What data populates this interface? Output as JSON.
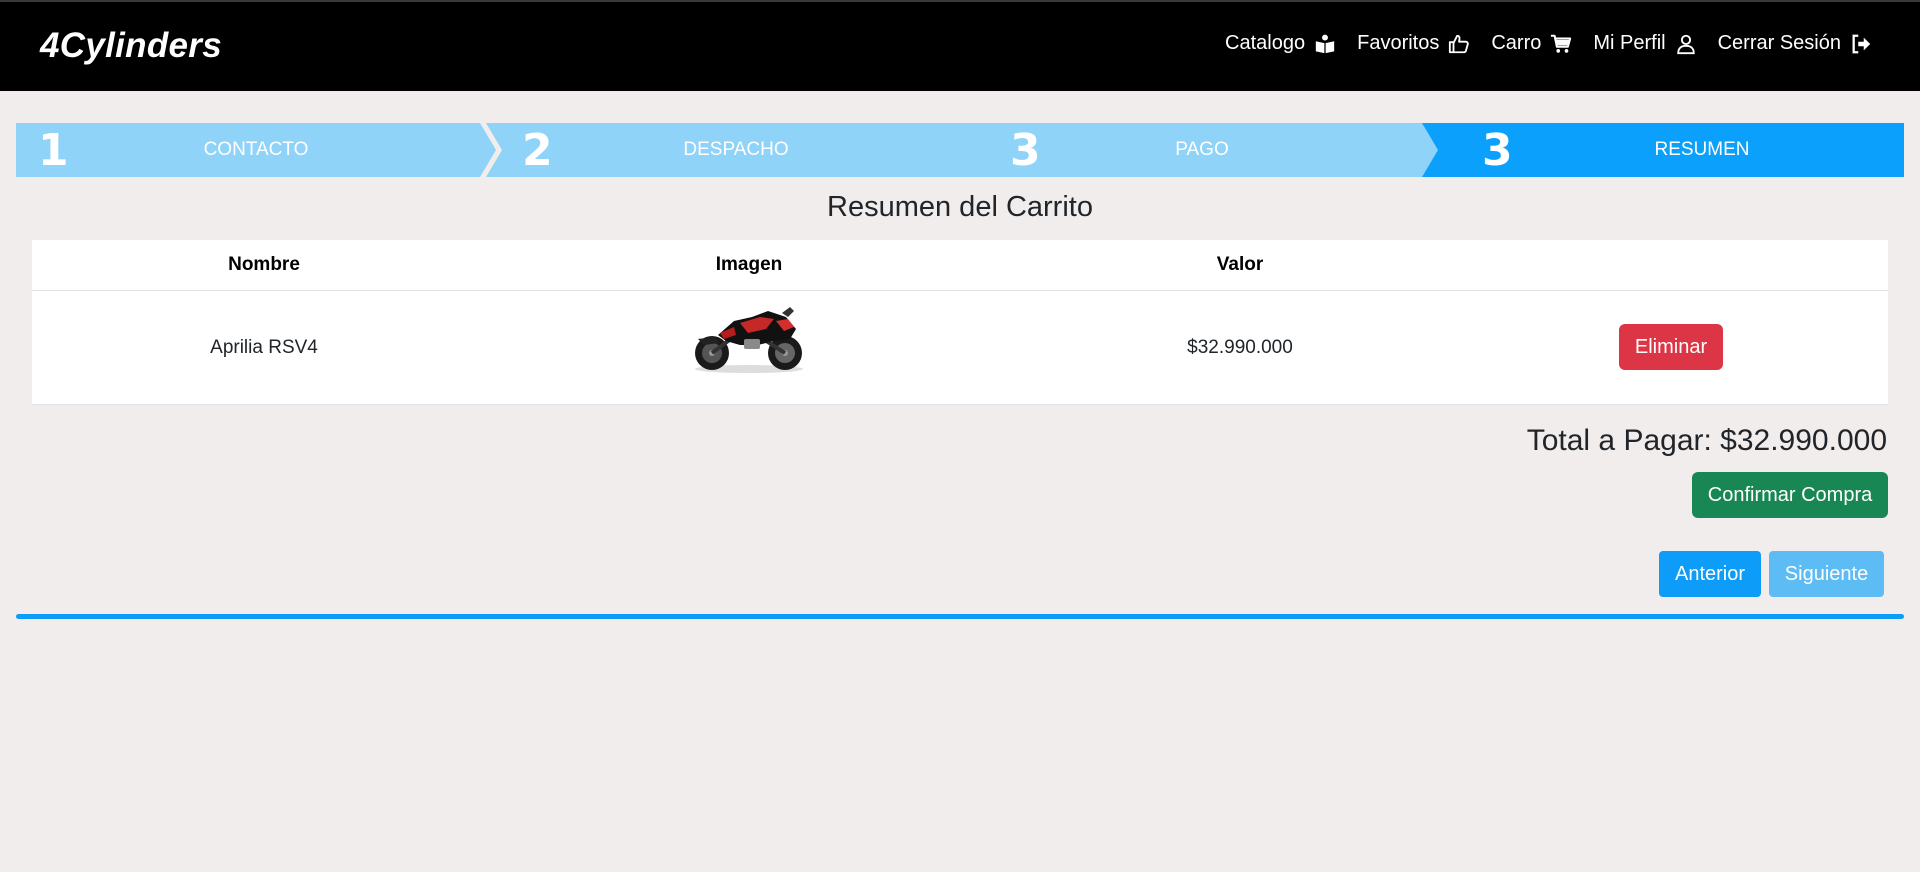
{
  "navbar": {
    "brand": "4Cylinders",
    "links": [
      {
        "label": "Catalogo",
        "icon": "book-reader-icon"
      },
      {
        "label": "Favoritos",
        "icon": "thumbs-up-icon"
      },
      {
        "label": "Carro",
        "icon": "cart-icon"
      },
      {
        "label": "Mi Perfil",
        "icon": "user-icon"
      },
      {
        "label": "Cerrar Sesión",
        "icon": "logout-icon"
      }
    ]
  },
  "stepper": {
    "steps": [
      {
        "number": "1",
        "label": "CONTACTO",
        "active": false
      },
      {
        "number": "2",
        "label": "DESPACHO",
        "active": false
      },
      {
        "number": "3",
        "label": "PAGO",
        "active": false
      },
      {
        "number": "3",
        "label": "RESUMEN",
        "active": true
      }
    ],
    "colors": {
      "inactive": "#8fd3f9",
      "active": "#0ba0fb"
    }
  },
  "cart": {
    "title": "Resumen del Carrito",
    "headers": [
      "Nombre",
      "Imagen",
      "Valor",
      ""
    ],
    "rows": [
      {
        "name": "Aprilia RSV4",
        "image": "motorcycle-image",
        "value": "$32.990.000",
        "action": "Eliminar"
      }
    ],
    "total_label": "Total a Pagar: $32.990.000",
    "confirm_label": "Confirmar Compra"
  },
  "navigation": {
    "prev_label": "Anterior",
    "next_label": "Siguiente"
  },
  "colors": {
    "danger": "#dc3545",
    "success": "#198754",
    "primary": "#0d9cf7",
    "primary_light": "#5ebcf5",
    "page_bg": "#f1eded"
  }
}
